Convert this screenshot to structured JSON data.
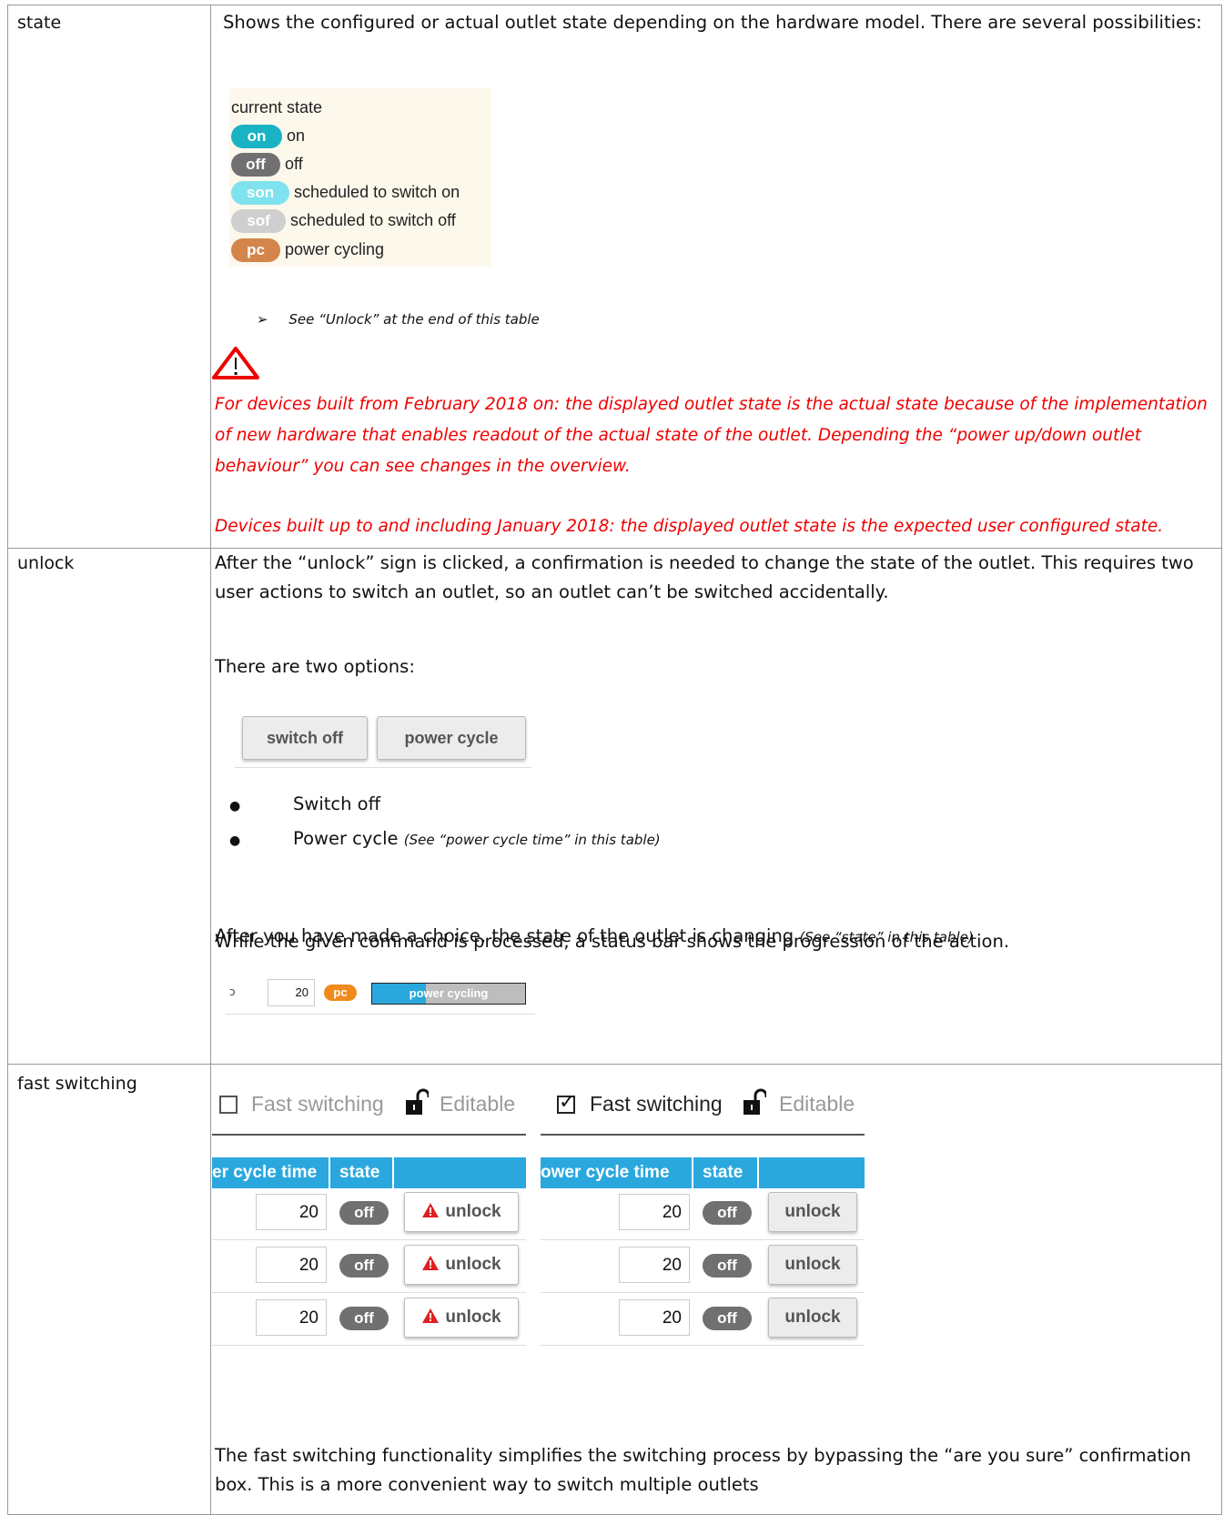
{
  "state_row": {
    "key": "state",
    "intro": "Shows the configured or actual outlet state depending on the hardware model. There are several possibilities:",
    "legend": {
      "title": "current state",
      "items": [
        {
          "pill": "on",
          "label": "on",
          "color": "#1ab3c4"
        },
        {
          "pill": "off",
          "label": "off",
          "color": "#707070"
        },
        {
          "pill": "son",
          "label": "scheduled to switch on",
          "color": "#7ee3ef"
        },
        {
          "pill": "sof",
          "label": "scheduled to switch off",
          "color": "#cfcfcf"
        },
        {
          "pill": "pc",
          "label": "power cycling",
          "color": "#d3854a"
        }
      ]
    },
    "arrow_glyph": "➢",
    "see_unlock": "See “Unlock” at the end of this table",
    "warning_1": "For devices built from February 2018 on: the displayed outlet state is the actual state because of the implementation of new hardware that enables readout of the actual state of the outlet. Depending the “power up/down outlet behaviour” you can see changes in the overview.",
    "warning_2": "Devices built up to and including January 2018: the displayed outlet state is the expected user configured state."
  },
  "unlock_row": {
    "key": "unlock",
    "intro": "After the “unlock” sign is clicked, a confirmation is needed to change the state of the outlet. This requires two user actions to switch an outlet, so an outlet can’t be switched accidentally.",
    "options_intro": "There are two options:",
    "button_switch_off": "switch off",
    "button_power_cycle": "power cycle",
    "bullet_1": "Switch off",
    "bullet_2": "Power cycle",
    "bullet_2_note": "(See “power cycle time” in  this table)",
    "after_choice": "After you have made a choice, the state of the outlet is changing",
    "after_choice_note": "(See “state” in  this table)",
    "status_line": "While the given command is processed, a status bar shows the progression of the action.",
    "status_example": {
      "edge_glyph": "ↄ",
      "value": "20",
      "pill": "pc",
      "bar_text": "power cycling",
      "progress": 0.35
    }
  },
  "fast_row": {
    "key": "fast switching",
    "left_panel": {
      "checkbox_label": "Fast switching",
      "checked": false,
      "editable_label": "Editable",
      "col_time": "er cycle time",
      "col_state": "state",
      "rows": [
        {
          "value": "20",
          "state": "off",
          "action": "unlock"
        },
        {
          "value": "20",
          "state": "off",
          "action": "unlock"
        },
        {
          "value": "20",
          "state": "off",
          "action": "unlock"
        }
      ]
    },
    "right_panel": {
      "checkbox_label": "Fast switching",
      "checked": true,
      "checkmark": "✓",
      "editable_label": "Editable",
      "col_time": "ower cycle time",
      "col_state": "state",
      "rows": [
        {
          "value": "20",
          "state": "off",
          "action": "unlock"
        },
        {
          "value": "20",
          "state": "off",
          "action": "unlock"
        },
        {
          "value": "20",
          "state": "off",
          "action": "unlock"
        }
      ]
    },
    "description": "The fast switching functionality simplifies the switching process by bypassing the “are you sure” confirmation box. This is a more convenient way to switch multiple outlets"
  }
}
